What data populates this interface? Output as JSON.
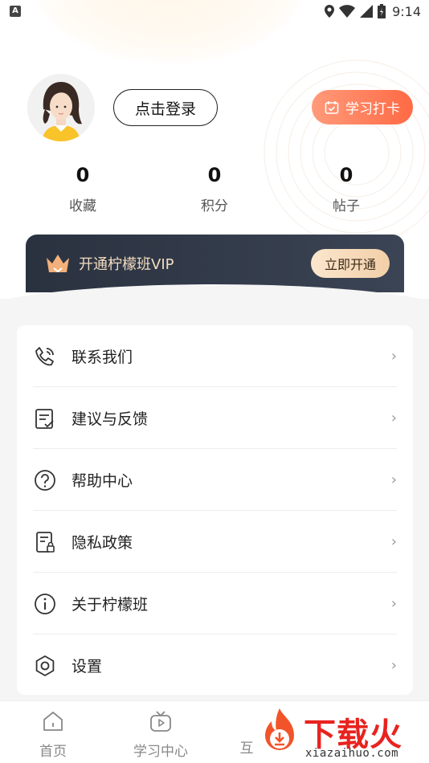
{
  "status_bar": {
    "left_badge": "A",
    "time": "9:14"
  },
  "profile": {
    "login_label": "点击登录",
    "checkin_label": "学习打卡"
  },
  "stats": [
    {
      "value": "0",
      "label": "收藏"
    },
    {
      "value": "0",
      "label": "积分"
    },
    {
      "value": "0",
      "label": "帖子"
    }
  ],
  "vip": {
    "title": "开通柠檬班VIP",
    "button_label": "立即开通"
  },
  "menu": [
    {
      "label": "联系我们",
      "icon": "phone-icon"
    },
    {
      "label": "建议与反馈",
      "icon": "feedback-icon"
    },
    {
      "label": "帮助中心",
      "icon": "help-icon"
    },
    {
      "label": "隐私政策",
      "icon": "privacy-icon"
    },
    {
      "label": "关于柠檬班",
      "icon": "info-icon"
    },
    {
      "label": "设置",
      "icon": "settings-icon"
    }
  ],
  "menu_arrow": "›",
  "bottom_nav": [
    {
      "label": "首页",
      "icon": "home-icon"
    },
    {
      "label": "学习中心",
      "icon": "tv-icon"
    },
    {
      "label": "互",
      "icon": "community-icon"
    }
  ],
  "watermark": {
    "text": "下载火",
    "url": "xiazaihuo.com"
  },
  "colors": {
    "accent": "#ff6a44",
    "vip_bg": "#2a3240",
    "vip_text": "#f3dcc0"
  }
}
